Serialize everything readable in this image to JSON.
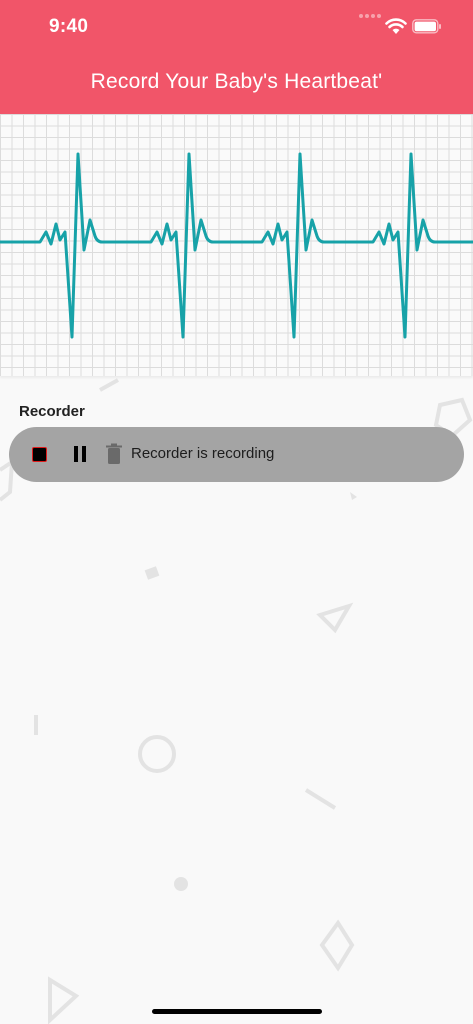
{
  "status_bar": {
    "time": "9:40",
    "icons": [
      "signal-dots-icon",
      "wifi-icon",
      "battery-icon"
    ]
  },
  "header": {
    "title": "Record Your Baby's Heartbeat'",
    "background_color": "#f15569"
  },
  "ecg": {
    "line_color": "#17a2a8",
    "beats": 4
  },
  "recorder": {
    "section_label": "Recorder",
    "status_text": "Recorder is recording",
    "controls": [
      "stop-icon",
      "pause-icon",
      "delete-icon"
    ],
    "bar_color": "#a4a4a4"
  }
}
